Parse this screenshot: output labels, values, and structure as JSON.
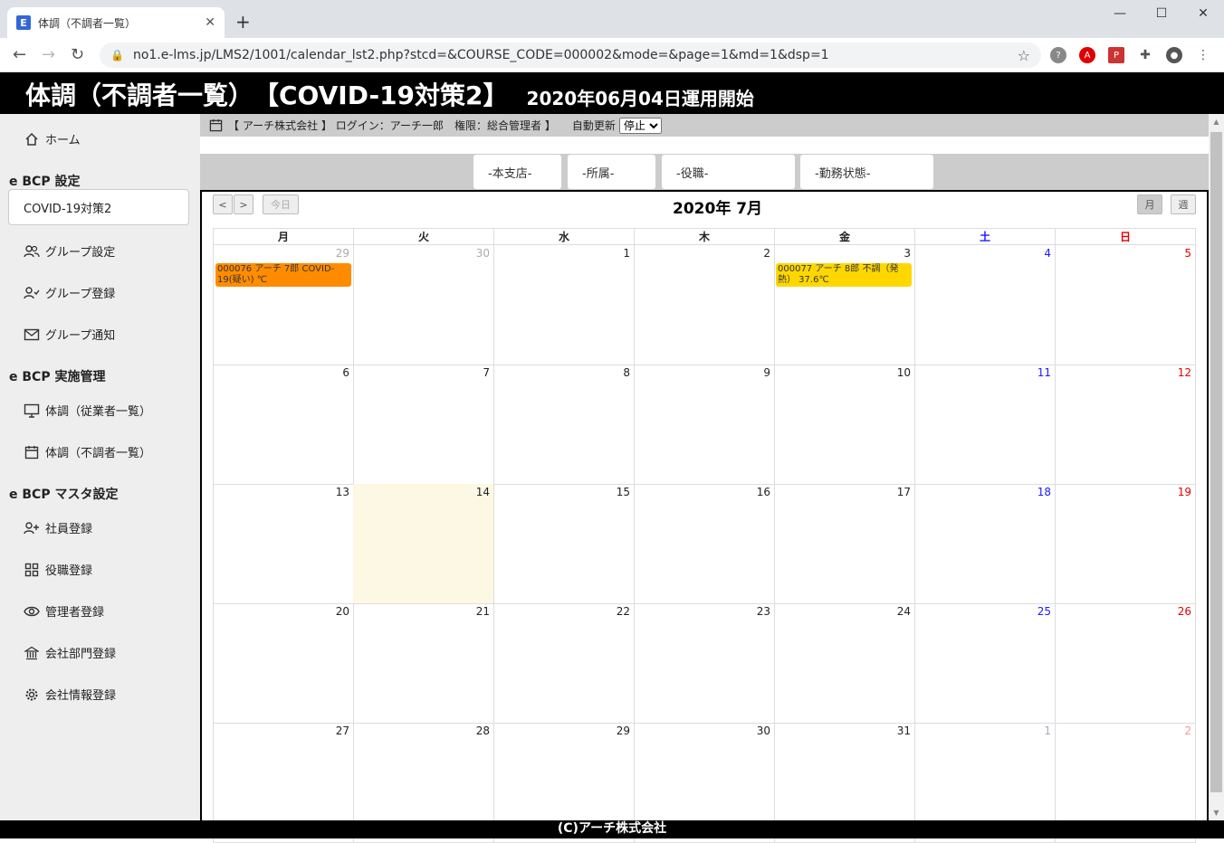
{
  "browser": {
    "tab_title": "体調（不調者一覧）",
    "favicon_letter": "E",
    "url": "no1.e-lms.jp/LMS2/1001/calendar_lst2.php?stcd=&COURSE_CODE=000002&mode=&page=1&md=1&dsp=1"
  },
  "banner": {
    "title": "体調（不調者一覧）　【COVID-19対策2】",
    "subtitle": "2020年06月04日運用開始"
  },
  "sidebar": {
    "home": "ホーム",
    "section1": "e BCP 設定",
    "course": "COVID-19対策2",
    "group_settings": "グループ設定",
    "group_register": "グループ登録",
    "group_notify": "グループ通知",
    "section2": "e BCP 実施管理",
    "health_employees": "体調（従業者一覧）",
    "health_unwell": "体調（不調者一覧）",
    "section3": "e BCP マスタ設定",
    "employee_register": "社員登録",
    "position_register": "役職登録",
    "admin_register": "管理者登録",
    "dept_register": "会社部門登録",
    "company_register": "会社情報登録"
  },
  "infobar": {
    "text": "【 アーチ株式会社 】 ログイン：アーチ一郎　権限：総合管理者 】",
    "auto_label": "自動更新",
    "auto_value": "停止"
  },
  "filters": {
    "branch": "-本支店-",
    "dept": "-所属-",
    "position": "-役職-",
    "status": "-勤務状態-"
  },
  "calendar": {
    "title": "2020年 7月",
    "prev": "<",
    "next": ">",
    "today": "今日",
    "month": "月",
    "week": "週",
    "days": [
      "月",
      "火",
      "水",
      "木",
      "金",
      "土",
      "日"
    ],
    "weeks": [
      [
        "29",
        "30",
        "1",
        "2",
        "3",
        "4",
        "5"
      ],
      [
        "6",
        "7",
        "8",
        "9",
        "10",
        "11",
        "12"
      ],
      [
        "13",
        "14",
        "15",
        "16",
        "17",
        "18",
        "19"
      ],
      [
        "20",
        "21",
        "22",
        "23",
        "24",
        "25",
        "26"
      ],
      [
        "27",
        "28",
        "29",
        "30",
        "31",
        "1",
        "2"
      ]
    ],
    "events": [
      {
        "week": 0,
        "day": 0,
        "text": "000076 アーチ 7郎 COVID-19(疑い) ℃",
        "color": "#ff8c00"
      },
      {
        "week": 0,
        "day": 4,
        "text": "000077 アーチ 8郎 不調（発熱） 37.6℃",
        "color": "#ffd700"
      }
    ],
    "today_cell": {
      "week": 2,
      "day": 1
    }
  },
  "footer": "(C)アーチ株式会社"
}
